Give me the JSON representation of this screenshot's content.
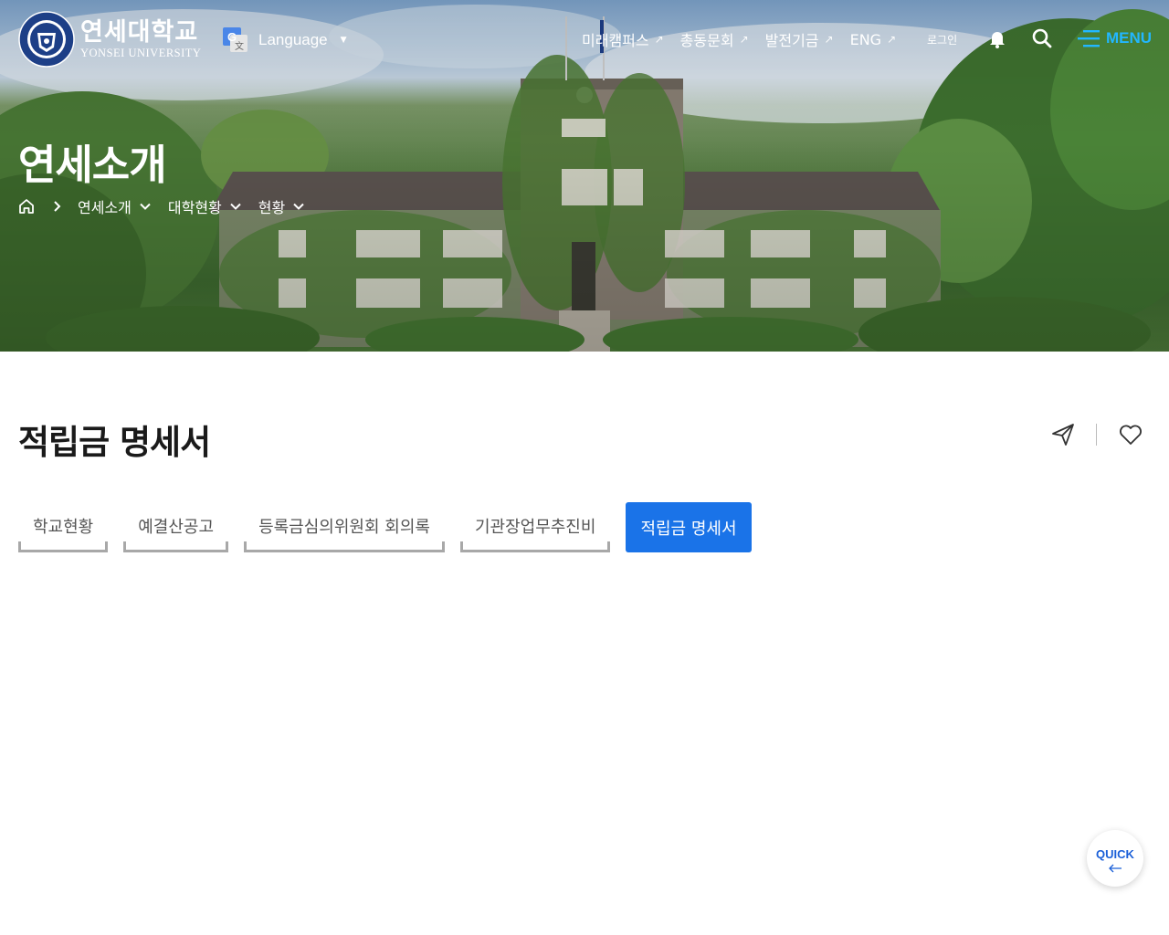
{
  "header": {
    "logo": {
      "korean": "연세대학교",
      "english": "YONSEI UNIVERSITY"
    },
    "language": {
      "label": "Language"
    },
    "nav_links": [
      {
        "label": "미래캠퍼스"
      },
      {
        "label": "총동문회"
      },
      {
        "label": "발전기금"
      },
      {
        "label": "ENG"
      }
    ],
    "login_label": "로그인",
    "menu_label": "MENU"
  },
  "hero": {
    "title": "연세소개",
    "breadcrumb": [
      "연세소개",
      "대학현황",
      "현황"
    ]
  },
  "main": {
    "page_title": "적립금 명세서",
    "tabs": [
      {
        "label": "학교현황",
        "active": false
      },
      {
        "label": "예결산공고",
        "active": false
      },
      {
        "label": "등록금심의위원회 회의록",
        "active": false
      },
      {
        "label": "기관장업무추진비",
        "active": false
      },
      {
        "label": "적립금 명세서",
        "active": true
      }
    ]
  },
  "quick": {
    "label": "QUICK"
  },
  "colors": {
    "accent_blue": "#1a73e8",
    "menu_cyan": "#22b7ff",
    "quick_blue": "#1a5fd8"
  }
}
